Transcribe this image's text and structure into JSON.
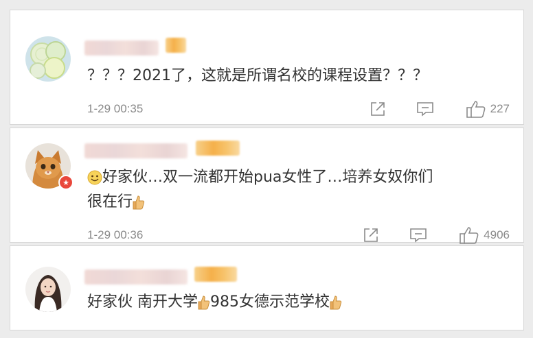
{
  "comments": [
    {
      "text": "？？？2021了，这就是所谓名校的课程设置？？？",
      "time": "1-29 00:35",
      "likes": "227"
    },
    {
      "text_line1": "好家伙…双一流都开始pua女性了…培养女奴你们",
      "text_line2": "很在行",
      "time": "1-29 00:36",
      "likes": "4906"
    },
    {
      "text_part1": "好家伙 南开大学",
      "text_part2": "985女德示范学校"
    }
  ],
  "icons": {
    "share": "share-icon",
    "reply": "reply-icon",
    "like": "thumbs-up-icon",
    "thumb_emoji": "thumbs-up-emoji",
    "smile_emoji": "smile-emoji",
    "verified": "verified-badge-icon"
  },
  "colors": {
    "meta_gray": "#8a8a8a",
    "text": "#333333",
    "verified_red": "#e9473b",
    "blur_orange": "#f5b04a"
  }
}
